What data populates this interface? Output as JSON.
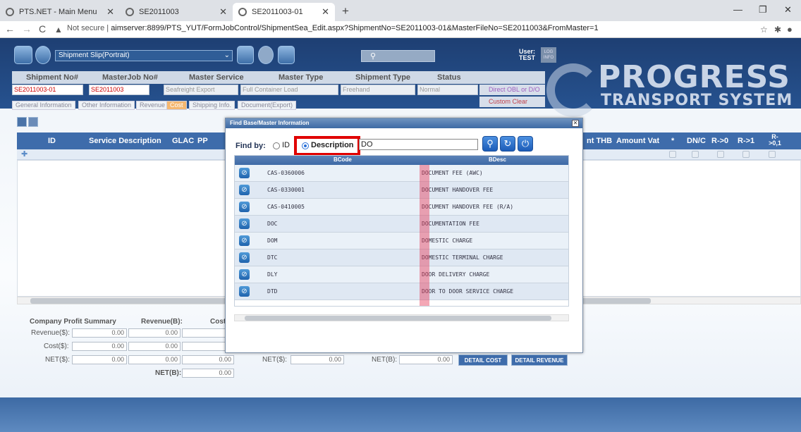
{
  "browser": {
    "tabs": [
      {
        "title": "PTS.NET - Main Menu"
      },
      {
        "title": "SE2011003"
      },
      {
        "title": "SE2011003-01"
      }
    ],
    "url_prefix": "Not secure",
    "url": "aimserver:8899/PTS_YUT/FormJobControl/ShipmentSea_Edit.aspx?ShipmentNo=SE2011003-01&MasterFileNo=SE2011003&FromMaster=1"
  },
  "toolbar": {
    "form_select": "Shipment Slip(Portrait)",
    "user_label": "User:",
    "user_name": "TEST",
    "log_label": "LOG INFO"
  },
  "logo": {
    "line1": "PROGRESS",
    "line2": "TRANSPORT SYSTEM"
  },
  "header": {
    "cols": [
      "Shipment No#",
      "MasterJob No#",
      "Master Service",
      "Master Type",
      "Shipment Type",
      "Status"
    ],
    "shipment_no": "SE2011003-01",
    "master_job_no": "SE2011003",
    "master_service": "Seafreight Export",
    "master_type": "Full Container Load",
    "shipment_type": "Freehand",
    "status": "Normal",
    "direct_obl": "Direct OBL or D/O",
    "custom_clear": "Custom Clear"
  },
  "subtabs": [
    "General Information",
    "Other Information",
    "Revenue",
    "Cost",
    "Shipping Info.",
    "Document(Export)"
  ],
  "grid": {
    "cols": [
      "ID",
      "Service Description",
      "GLAC",
      "PP",
      "nt THB",
      "Amount Vat",
      "*",
      "DN/C",
      "R->0",
      "R->1",
      "R->0,1"
    ]
  },
  "summary": {
    "title": "Company Profit Summary",
    "revenue_b_label": "Revenue(B):",
    "cost_label": "Cost",
    "rows": [
      {
        "label": "Revenue($):",
        "a": "0.00",
        "b": "0.00"
      },
      {
        "label": "Cost($):",
        "a": "0.00",
        "b": "0.00"
      },
      {
        "label": "NET($):",
        "a": "0.00",
        "b": "0.00",
        "c": "0.00"
      }
    ],
    "net_b_label": "NET(B):",
    "net_b_value": "0.00",
    "net_s_label2": "NET($):",
    "net_s_value2": "0.00",
    "net_b_label2": "NET(B):",
    "net_b_value2": "0.00",
    "detail_cost": "DETAIL COST",
    "detail_revenue": "DETAIL REVENUE"
  },
  "modal": {
    "title": "Find Base/Master Information",
    "find_by": "Find by:",
    "opt_id": "ID",
    "opt_desc": "Description",
    "search_value": "DO",
    "col_code": "BCode",
    "col_desc": "BDesc",
    "rows": [
      {
        "code": "CAS-0360006",
        "desc": "DOCUMENT FEE (AWC)"
      },
      {
        "code": "CAS-0330001",
        "desc": "DOCUMENT HANDOVER FEE"
      },
      {
        "code": "CAS-0410005",
        "desc": "DOCUMENT HANDOVER FEE (R/A)"
      },
      {
        "code": "DOC",
        "desc": "DOCUMENTATION FEE"
      },
      {
        "code": "DOM",
        "desc": "DOMESTIC CHARGE"
      },
      {
        "code": "DTC",
        "desc": "DOMESTIC TERMINAL CHARGE"
      },
      {
        "code": "DLY",
        "desc": "DOOR DELIVERY CHARGE"
      },
      {
        "code": "DTD",
        "desc": "DOOR TO DOOR SERVICE CHARGE"
      }
    ]
  }
}
